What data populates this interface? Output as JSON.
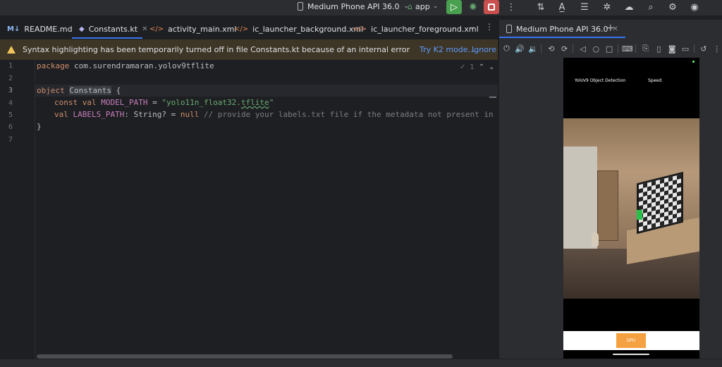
{
  "toolbar": {
    "device": "Medium Phone API 36.0",
    "run_config": "app"
  },
  "tabs": [
    {
      "label": "README.md",
      "icon": "M↓"
    },
    {
      "label": "Constants.kt",
      "icon": "◆"
    },
    {
      "label": "activity_main.xml",
      "icon": "</>"
    },
    {
      "label": "ic_launcher_background.xml",
      "icon": "</>"
    },
    {
      "label": "ic_launcher_foreground.xml",
      "icon": "</>"
    }
  ],
  "banner": {
    "message": "Syntax highlighting has been temporarily turned off in file Constants.kt because of an internal error",
    "try_k2": "Try K2 mode...",
    "ignore": "Ignore"
  },
  "editor": {
    "line_numbers": [
      "1",
      "2",
      "3",
      "4",
      "5",
      "6",
      "7"
    ],
    "inspection_count": "1",
    "code": {
      "l1_kw": "package",
      "l1_rest": " com.surendramaran.yolov9tflite",
      "l3_kw": "object",
      "l3_name": "Constants",
      "l3_rest": " {",
      "l4_kw": "const val",
      "l4_prop": "MODEL_PATH",
      "l4_eq": " = ",
      "l4_str_a": "\"yolo11n_float32.",
      "l4_str_b": "tflite",
      "l4_str_c": "\"",
      "l5_kw": "val",
      "l5_prop": "LABELS_PATH",
      "l5_type": ": String? = ",
      "l5_null": "null",
      "l5_cmt": " // provide your labels.txt file if the metadata not present in the mo",
      "l6": "}"
    }
  },
  "device_panel": {
    "tab_label": "Medium Phone API 36.0"
  },
  "phone": {
    "app_title": "YoloV9 Object Detection",
    "speed_label": "Speed:",
    "gpu_button": "GPU"
  }
}
